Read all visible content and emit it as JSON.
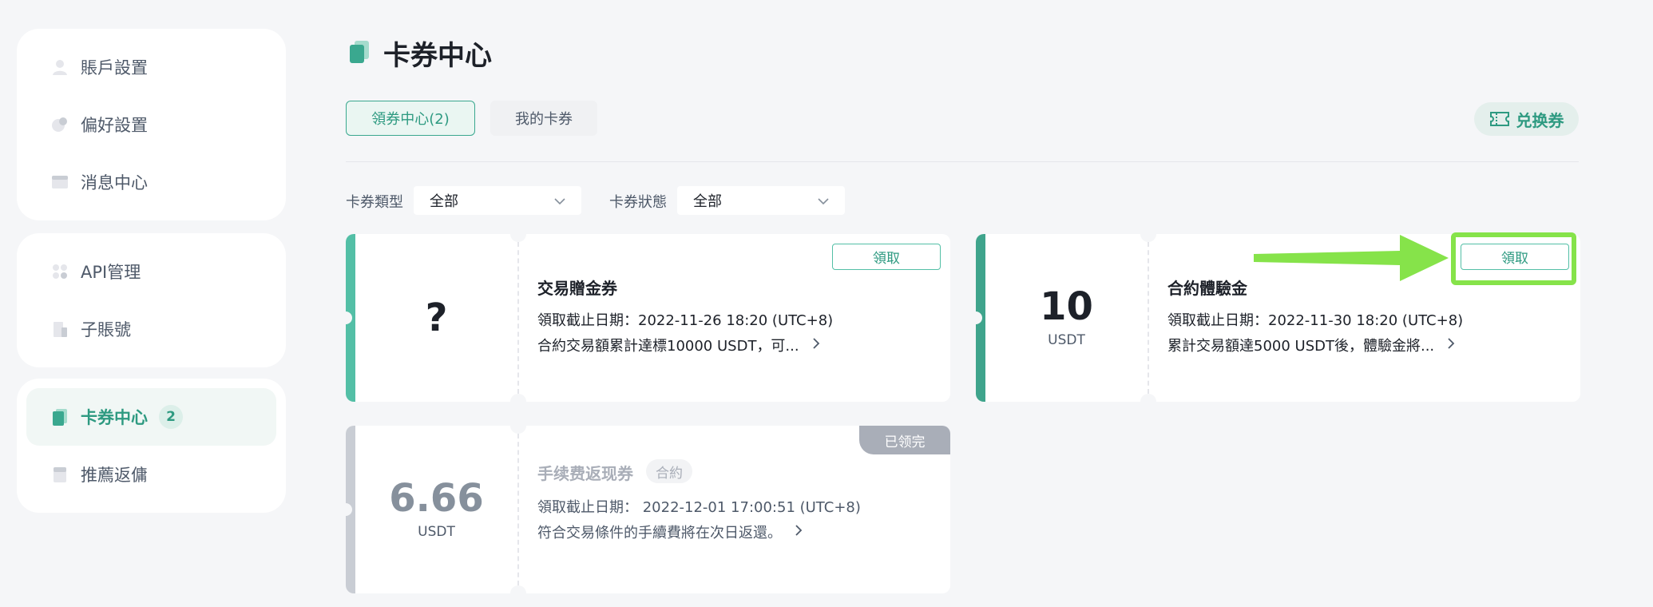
{
  "sidebar": {
    "groups": [
      {
        "items": [
          {
            "label": "賬戶設置",
            "icon": "user-icon"
          },
          {
            "label": "偏好設置",
            "icon": "preferences-icon"
          },
          {
            "label": "消息中心",
            "icon": "message-icon"
          }
        ]
      },
      {
        "items": [
          {
            "label": "API管理",
            "icon": "api-icon"
          },
          {
            "label": "子賬號",
            "icon": "sub-account-icon"
          }
        ]
      },
      {
        "items": [
          {
            "label": "卡券中心",
            "icon": "coupon-icon",
            "badge": "2",
            "active": true
          },
          {
            "label": "推薦返傭",
            "icon": "referral-icon"
          }
        ]
      }
    ]
  },
  "header": {
    "title": "卡券中心",
    "tabs": [
      {
        "label": "領券中心(2)",
        "active": true
      },
      {
        "label": "我的卡券",
        "active": false
      }
    ],
    "redeem_label": "兑换券"
  },
  "filters": {
    "type_label": "卡券類型",
    "type_value": "全部",
    "status_label": "卡券狀態",
    "status_value": "全部"
  },
  "coupons": [
    {
      "amount": "?",
      "unit": "",
      "title": "交易贈金券",
      "deadline": "領取截止日期：2022-11-26 18:20 (UTC+8)",
      "description": "合約交易額累計達標10000 USDT，可...",
      "action": "領取"
    },
    {
      "amount": "10",
      "unit": "USDT",
      "title": "合約體驗金",
      "deadline": "領取截止日期：2022-11-30 18:20 (UTC+8)",
      "description": "累計交易額達5000 USDT後，體驗金將...",
      "action": "領取"
    },
    {
      "amount": "6.66",
      "unit": "USDT",
      "title": "手续费返现券",
      "tag": "合約",
      "deadline": "領取截止日期： 2022-12-01 17:00:51 (UTC+8)",
      "description": "符合交易條件的手續費將在次日返還。",
      "status": "已领完"
    }
  ],
  "colors": {
    "accent": "#2e9a81",
    "stripe": "#53bfa6",
    "used": "#a9aeb8",
    "highlight": "#86e34a"
  }
}
